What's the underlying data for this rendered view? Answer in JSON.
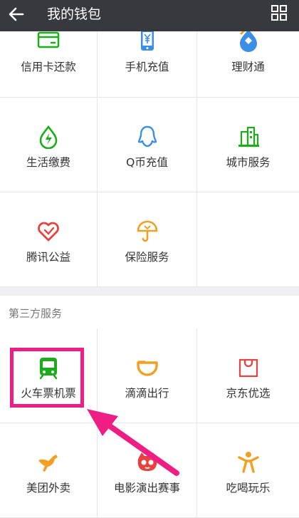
{
  "header": {
    "title": "我的钱包"
  },
  "services": [
    {
      "label": "信用卡还款",
      "icon": "credit-card-icon"
    },
    {
      "label": "手机充值",
      "icon": "phone-yuan-icon"
    },
    {
      "label": "理财通",
      "icon": "wealth-drop-icon"
    },
    {
      "label": "生活缴费",
      "icon": "lightning-drop-icon"
    },
    {
      "label": "Q币充值",
      "icon": "qq-penguin-icon"
    },
    {
      "label": "城市服务",
      "icon": "city-buildings-icon"
    },
    {
      "label": "腾讯公益",
      "icon": "charity-heart-icon"
    },
    {
      "label": "保险服务",
      "icon": "umbrella-shield-icon"
    }
  ],
  "third_party": {
    "title": "第三方服务",
    "items": [
      {
        "label": "火车票机票",
        "icon": "train-icon"
      },
      {
        "label": "滴滴出行",
        "icon": "didi-icon"
      },
      {
        "label": "京东优选",
        "icon": "shopping-bag-icon"
      },
      {
        "label": "美团外卖",
        "icon": "kangaroo-icon"
      },
      {
        "label": "电影演出赛事",
        "icon": "cat-eye-icon"
      },
      {
        "label": "吃喝玩乐",
        "icon": "person-jump-icon"
      }
    ]
  },
  "colors": {
    "header_bg": "#38393e",
    "green": "#1aad19",
    "blue": "#3d8ee6",
    "red": "#e64340",
    "orange": "#f1a021",
    "highlight": "#ee1e84"
  }
}
